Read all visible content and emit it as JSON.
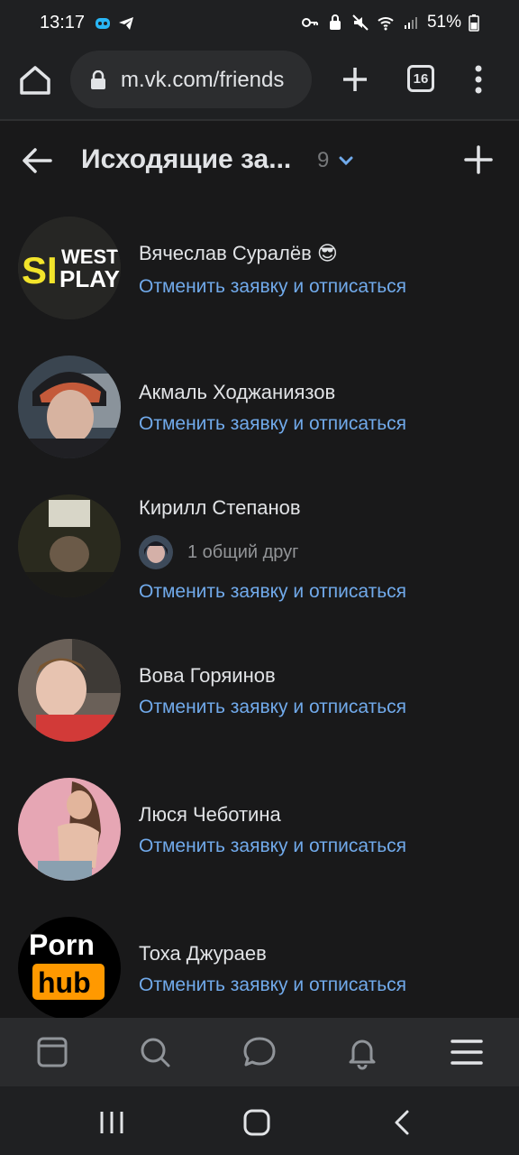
{
  "status_bar": {
    "time": "13:17",
    "battery": "51%"
  },
  "browser": {
    "url": "m.vk.com/friends",
    "tab_count": "16"
  },
  "header": {
    "title": "Исходящие за...",
    "count": "9"
  },
  "friends": [
    {
      "name": "Вячеслав Суралёв 😎",
      "action": "Отменить заявку и отписаться",
      "avatar_text_1": "SI",
      "avatar_text_2": "WEST",
      "avatar_text_3": "PLAY"
    },
    {
      "name": "Акмаль Ходжаниязов",
      "action": "Отменить заявку и отписаться"
    },
    {
      "name": "Кирилл Степанов",
      "mutual": "1 общий друг",
      "action": "Отменить заявку и отписаться"
    },
    {
      "name": "Вова Горяинов",
      "action": "Отменить заявку и отписаться"
    },
    {
      "name": "Люся Чеботина",
      "action": "Отменить заявку и отписаться"
    },
    {
      "name": "Тоха Джураев",
      "action": "Отменить заявку и отписаться",
      "avatar_text_1": "Porn",
      "avatar_text_2": "hub"
    }
  ],
  "colors": {
    "background": "#19191a",
    "link": "#71aaeb",
    "text": "#e1e3e6",
    "secondary": "#76787a"
  }
}
